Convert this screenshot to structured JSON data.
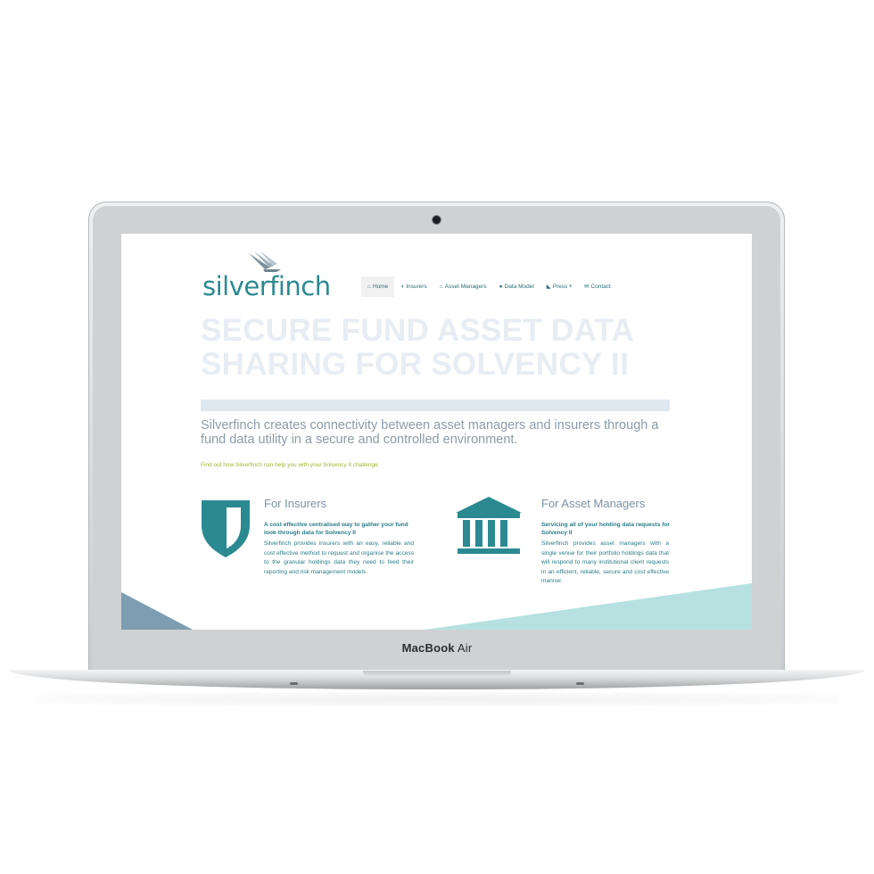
{
  "device": {
    "model_label_1": "MacBook",
    "model_label_2": "Air"
  },
  "site": {
    "logo_text": "silverfinch",
    "nav": [
      {
        "label": "Home",
        "icon": "home-icon"
      },
      {
        "label": "Insurers",
        "icon": "shield-icon"
      },
      {
        "label": "Asset Managers",
        "icon": "bank-icon"
      },
      {
        "label": "Data Model",
        "icon": "globe-icon"
      },
      {
        "label": "Press",
        "icon": "rss-icon",
        "caret": "▾"
      },
      {
        "label": "Contact",
        "icon": "envelope-icon"
      }
    ],
    "hero_title_line1": "SECURE FUND ASSET DATA",
    "hero_title_line2": "SHARING FOR SOLVENCY II",
    "intro": "Silverfinch creates connectivity between asset managers and insurers through a fund data utility in a secure and controlled environment.",
    "cta": "Find out how Silverfinch can help you with your Solvency II challenge.",
    "insurers": {
      "title": "For Insurers",
      "subtitle": "A cost effective centralised way to gather your fund look-through data for Solvency II",
      "body": "Silverfinch provides insurers with an easy, reliable and cost effective method to request and organise the access to the granular holdings data they need to feed their reporting and risk management models."
    },
    "asset_managers": {
      "title": "For Asset Managers",
      "subtitle": "Servicing all of your holding data requests for Solvency II",
      "body": "Silverfinch provides asset managers with a single venue for their portfolio holdings data that will respond to many institutional client requests in an efficient, reliable, secure and cost effective manner."
    },
    "colors": {
      "brand_teal": "#2b8a91",
      "accent_green": "#a1b332",
      "triangle_blue": "#7d9db3",
      "triangle_mint": "#b6e1e0"
    }
  }
}
